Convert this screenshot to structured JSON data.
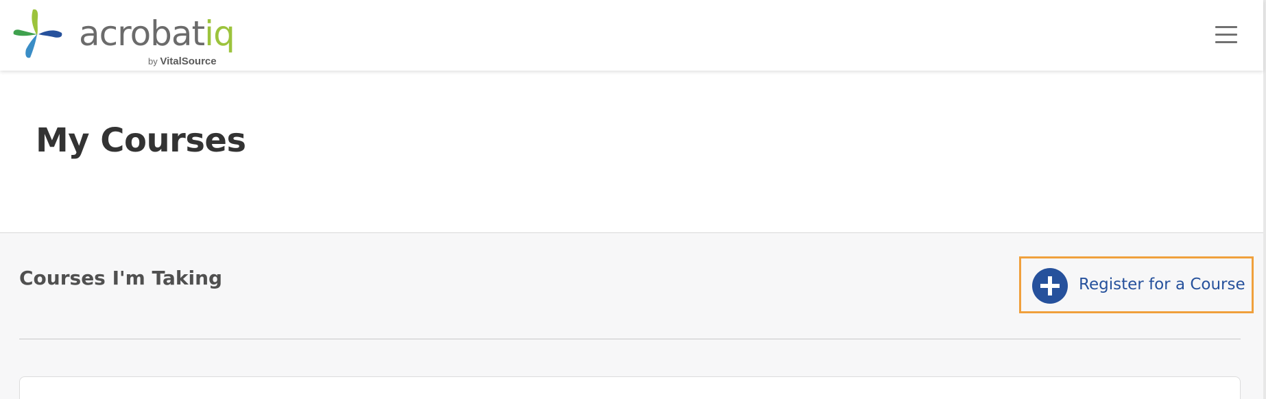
{
  "header": {
    "logo": {
      "text_main": "acrobat",
      "text_accent": "iq",
      "by_label": "by",
      "vendor": "VitalSource",
      "icon": "pinwheel-logo-icon"
    },
    "menu_icon": "hamburger-menu-icon"
  },
  "page": {
    "title": "My Courses"
  },
  "courses_section": {
    "title": "Courses I'm Taking",
    "register_button": {
      "label": "Register for a Course",
      "icon": "plus-circle-icon"
    }
  },
  "colors": {
    "brand_gray": "#6b6b6b",
    "brand_green": "#9cc33c",
    "primary_blue": "#26519c",
    "highlight_orange": "#f0a03c",
    "section_background": "#f7f7f8"
  }
}
